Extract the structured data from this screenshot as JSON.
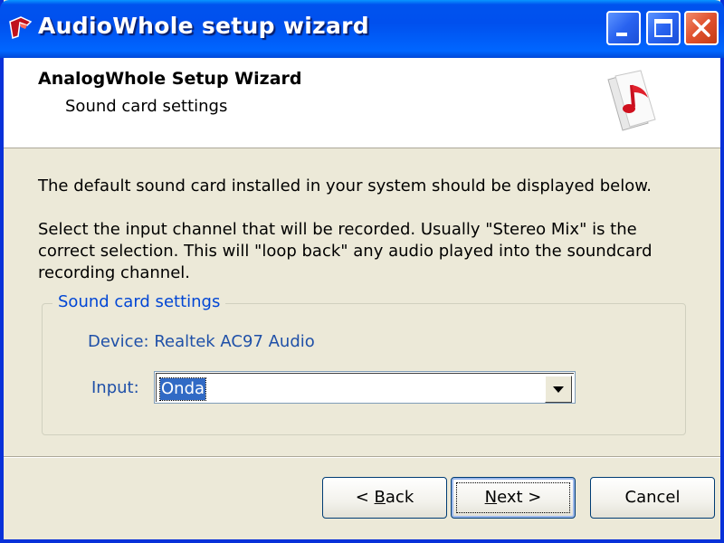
{
  "window": {
    "title": "AudioWhole setup wizard",
    "controls": [
      "minimize",
      "maximize",
      "close"
    ]
  },
  "header": {
    "title": "AnalogWhole Setup Wizard",
    "subtitle": "Sound card settings",
    "icon": "music-note-icon"
  },
  "body": {
    "text1": "The default sound card installed in your system should be displayed below.",
    "text2": "Select the input channel that will be recorded.  Usually \"Stereo Mix\" is the correct selection.  This will \"loop back\" any audio played into the soundcard recording channel."
  },
  "group": {
    "legend": "Sound card settings",
    "device": "Device: Realtek AC97 Audio",
    "input_label": "Input:",
    "input_value": "Onda"
  },
  "buttons": {
    "back_pre": "< ",
    "back_key": "B",
    "back_post": "ack",
    "next_pre": "",
    "next_key": "N",
    "next_post": "ext >",
    "cancel": "Cancel"
  },
  "colors": {
    "titlebar": "#0053ee",
    "close_button": "#e0512d",
    "selection": "#316ac5",
    "group_label": "#1f50a8"
  }
}
